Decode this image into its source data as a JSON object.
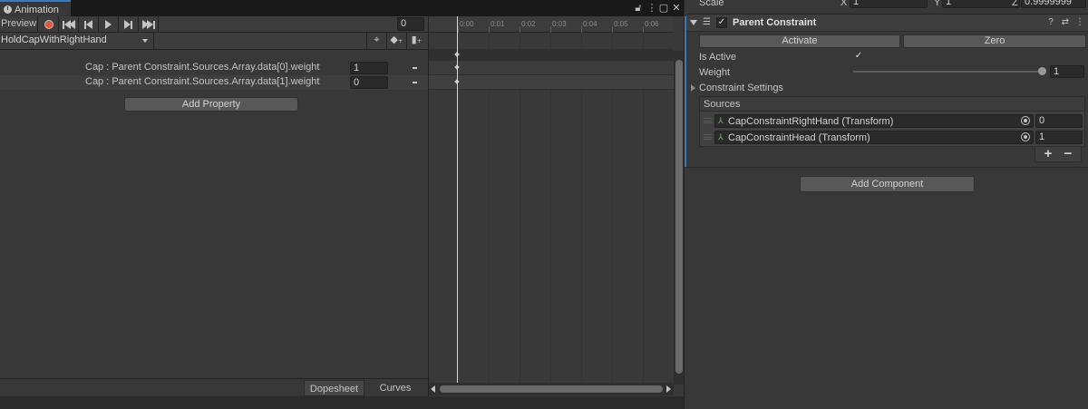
{
  "animation": {
    "tab_title": "Animation",
    "preview_label": "Preview",
    "frame_value": "0",
    "clip_name": "HoldCapWithRightHand",
    "properties": [
      {
        "label": "Cap : Parent Constraint.Sources.Array.data[0].weight",
        "value": "1"
      },
      {
        "label": "Cap : Parent Constraint.Sources.Array.data[1].weight",
        "value": "0"
      }
    ],
    "add_property_label": "Add Property",
    "tabs": {
      "dopesheet": "Dopesheet",
      "curves": "Curves"
    },
    "ruler_labels": [
      "0:00",
      "0:01",
      "0:02",
      "0:03",
      "0:04",
      "0:05",
      "0:06"
    ]
  },
  "inspector": {
    "scale_label": "Scale",
    "scale_x_label": "X",
    "scale_x": "1",
    "scale_y_label": "Y",
    "scale_y": "1",
    "scale_z_label": "Z",
    "scale_z": "0.9999999",
    "component_title": "Parent Constraint",
    "component_enabled": true,
    "activate_label": "Activate",
    "zero_label": "Zero",
    "is_active_label": "Is Active",
    "is_active": true,
    "weight_label": "Weight",
    "weight_value": "1",
    "weight_fraction": 1.0,
    "settings_label": "Constraint Settings",
    "sources_label": "Sources",
    "sources": [
      {
        "name": "CapConstraintRightHand (Transform)",
        "weight": "0"
      },
      {
        "name": "CapConstraintHead (Transform)",
        "weight": "1"
      }
    ],
    "plus_label": "+",
    "minus_label": "−",
    "add_component_label": "Add Component"
  },
  "icons": {
    "record": "record-icon",
    "first_key": "first-key-icon",
    "prev_key": "prev-key-icon",
    "play": "play-icon",
    "next_key": "next-key-icon",
    "last_key": "last-key-icon",
    "accent_color": "#3a79bb",
    "record_color": "#e0573c"
  }
}
